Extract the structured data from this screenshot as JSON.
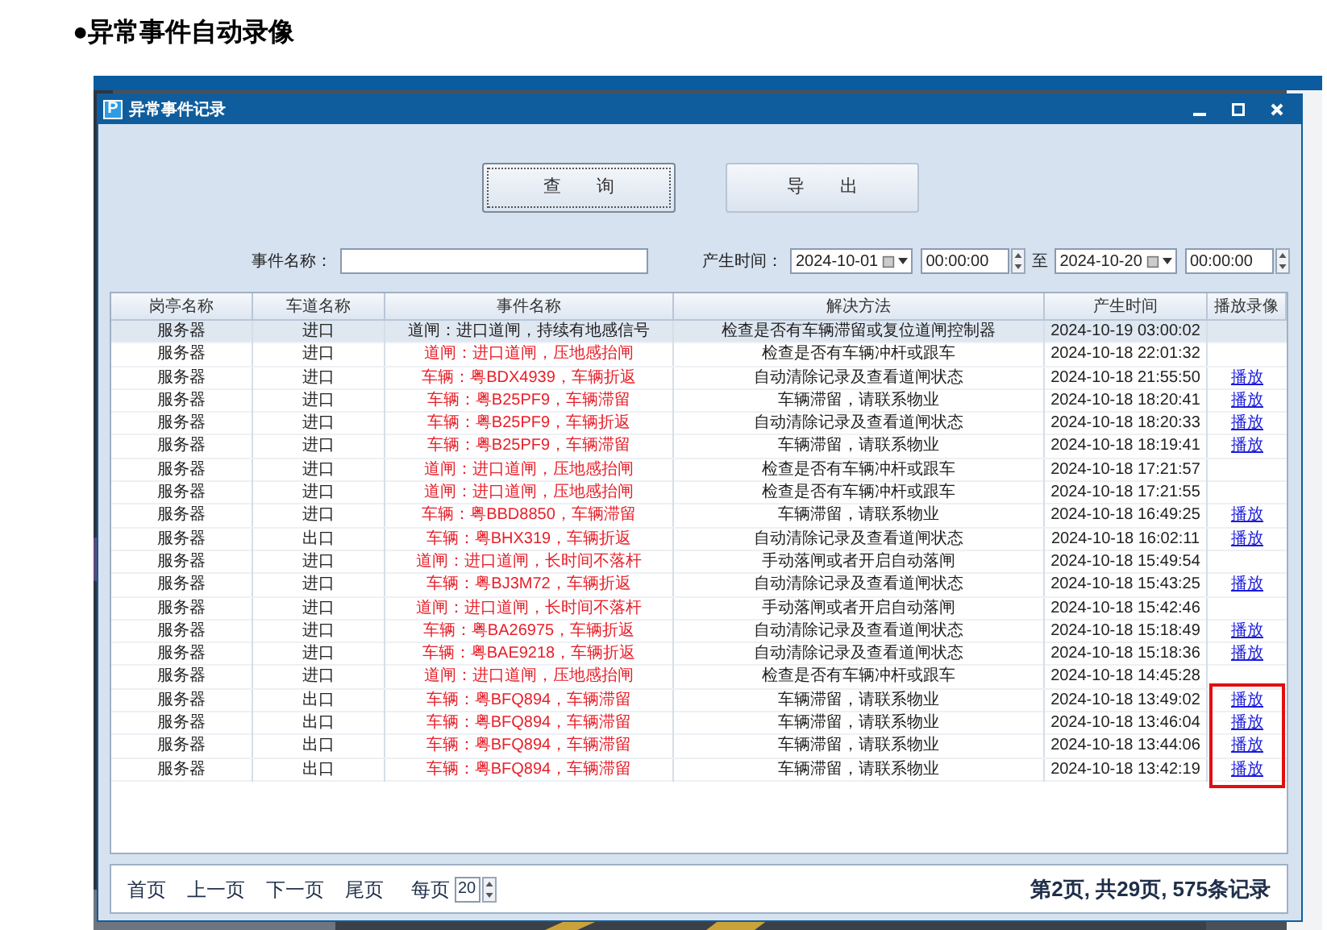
{
  "heading": "●异常事件自动录像",
  "window": {
    "title": "异常事件记录",
    "icon": "P"
  },
  "buttons": [
    "查　　询",
    "导　　出"
  ],
  "search": {
    "event_label": "事件名称：",
    "time_label": "产生时间：",
    "start_date": "2024-10-01",
    "start_time": "00:00:00",
    "to": "至",
    "end_date": "2024-10-20",
    "end_time": "00:00:00"
  },
  "table": {
    "columns": [
      "岗亭名称",
      "车道名称",
      "事件名称",
      "解决方法",
      "产生时间",
      "播放录像"
    ],
    "rows": [
      {
        "booth": "服务器",
        "lane": "进口",
        "event": "道闸：进口道闸，持续有地感信号",
        "solution": "检查是否有车辆滞留或复位道闸控制器",
        "time": "2024-10-19 03:00:02",
        "selected": true,
        "highlighted": false
      },
      {
        "booth": "服务器",
        "lane": "进口",
        "event": "道闸：进口道闸，压地感抬闸",
        "solution": "检查是否有车辆冲杆或跟车",
        "time": "2024-10-18 22:01:32",
        "selected": false,
        "highlighted": false
      },
      {
        "booth": "服务器",
        "lane": "进口",
        "event": "车辆：粤BDX4939，车辆折返",
        "solution": "自动清除记录及查看道闸状态",
        "time": "2024-10-18 21:55:50",
        "play": "播放",
        "selected": false,
        "highlighted": false
      },
      {
        "booth": "服务器",
        "lane": "进口",
        "event": "车辆：粤B25PF9，车辆滞留",
        "solution": "车辆滞留，请联系物业",
        "time": "2024-10-18 18:20:41",
        "play": "播放",
        "selected": false,
        "highlighted": false
      },
      {
        "booth": "服务器",
        "lane": "进口",
        "event": "车辆：粤B25PF9，车辆折返",
        "solution": "自动清除记录及查看道闸状态",
        "time": "2024-10-18 18:20:33",
        "play": "播放",
        "selected": false,
        "highlighted": false
      },
      {
        "booth": "服务器",
        "lane": "进口",
        "event": "车辆：粤B25PF9，车辆滞留",
        "solution": "车辆滞留，请联系物业",
        "time": "2024-10-18 18:19:41",
        "play": "播放",
        "selected": false,
        "highlighted": false
      },
      {
        "booth": "服务器",
        "lane": "进口",
        "event": "道闸：进口道闸，压地感抬闸",
        "solution": "检查是否有车辆冲杆或跟车",
        "time": "2024-10-18 17:21:57",
        "selected": false,
        "highlighted": false
      },
      {
        "booth": "服务器",
        "lane": "进口",
        "event": "道闸：进口道闸，压地感抬闸",
        "solution": "检查是否有车辆冲杆或跟车",
        "time": "2024-10-18 17:21:55",
        "selected": false,
        "highlighted": false
      },
      {
        "booth": "服务器",
        "lane": "进口",
        "event": "车辆：粤BBD8850，车辆滞留",
        "solution": "车辆滞留，请联系物业",
        "time": "2024-10-18 16:49:25",
        "play": "播放",
        "selected": false,
        "highlighted": false
      },
      {
        "booth": "服务器",
        "lane": "出口",
        "event": "车辆：粤BHX319，车辆折返",
        "solution": "自动清除记录及查看道闸状态",
        "time": "2024-10-18 16:02:11",
        "play": "播放",
        "selected": false,
        "highlighted": false
      },
      {
        "booth": "服务器",
        "lane": "进口",
        "event": "道闸：进口道闸，长时间不落杆",
        "solution": "手动落闸或者开启自动落闸",
        "time": "2024-10-18 15:49:54",
        "selected": false,
        "highlighted": false
      },
      {
        "booth": "服务器",
        "lane": "进口",
        "event": "车辆：粤BJ3M72，车辆折返",
        "solution": "自动清除记录及查看道闸状态",
        "time": "2024-10-18 15:43:25",
        "play": "播放",
        "selected": false,
        "highlighted": false
      },
      {
        "booth": "服务器",
        "lane": "进口",
        "event": "道闸：进口道闸，长时间不落杆",
        "solution": "手动落闸或者开启自动落闸",
        "time": "2024-10-18 15:42:46",
        "selected": false,
        "highlighted": false
      },
      {
        "booth": "服务器",
        "lane": "进口",
        "event": "车辆：粤BA26975，车辆折返",
        "solution": "自动清除记录及查看道闸状态",
        "time": "2024-10-18 15:18:49",
        "play": "播放",
        "selected": false,
        "highlighted": false
      },
      {
        "booth": "服务器",
        "lane": "进口",
        "event": "车辆：粤BAE9218，车辆折返",
        "solution": "自动清除记录及查看道闸状态",
        "time": "2024-10-18 15:18:36",
        "play": "播放",
        "selected": false,
        "highlighted": false
      },
      {
        "booth": "服务器",
        "lane": "进口",
        "event": "道闸：进口道闸，压地感抬闸",
        "solution": "检查是否有车辆冲杆或跟车",
        "time": "2024-10-18 14:45:28",
        "selected": false,
        "highlighted": false
      },
      {
        "booth": "服务器",
        "lane": "出口",
        "event": "车辆：粤BFQ894，车辆滞留",
        "solution": "车辆滞留，请联系物业",
        "time": "2024-10-18 13:49:02",
        "play": "播放",
        "selected": false,
        "highlighted": true
      },
      {
        "booth": "服务器",
        "lane": "出口",
        "event": "车辆：粤BFQ894，车辆滞留",
        "solution": "车辆滞留，请联系物业",
        "time": "2024-10-18 13:46:04",
        "play": "播放",
        "selected": false,
        "highlighted": true
      },
      {
        "booth": "服务器",
        "lane": "出口",
        "event": "车辆：粤BFQ894，车辆滞留",
        "solution": "车辆滞留，请联系物业",
        "time": "2024-10-18 13:44:06",
        "play": "播放",
        "selected": false,
        "highlighted": true
      },
      {
        "booth": "服务器",
        "lane": "出口",
        "event": "车辆：粤BFQ894，车辆滞留",
        "solution": "车辆滞留，请联系物业",
        "time": "2024-10-18 13:42:19",
        "play": "播放",
        "selected": false,
        "highlighted": true
      }
    ]
  },
  "pager": {
    "links": [
      "首页",
      "上一页",
      "下一页",
      "尾页"
    ],
    "per_page_label": "每页",
    "per_page": "20",
    "summary": "第2页, 共29页, 575条记录"
  }
}
